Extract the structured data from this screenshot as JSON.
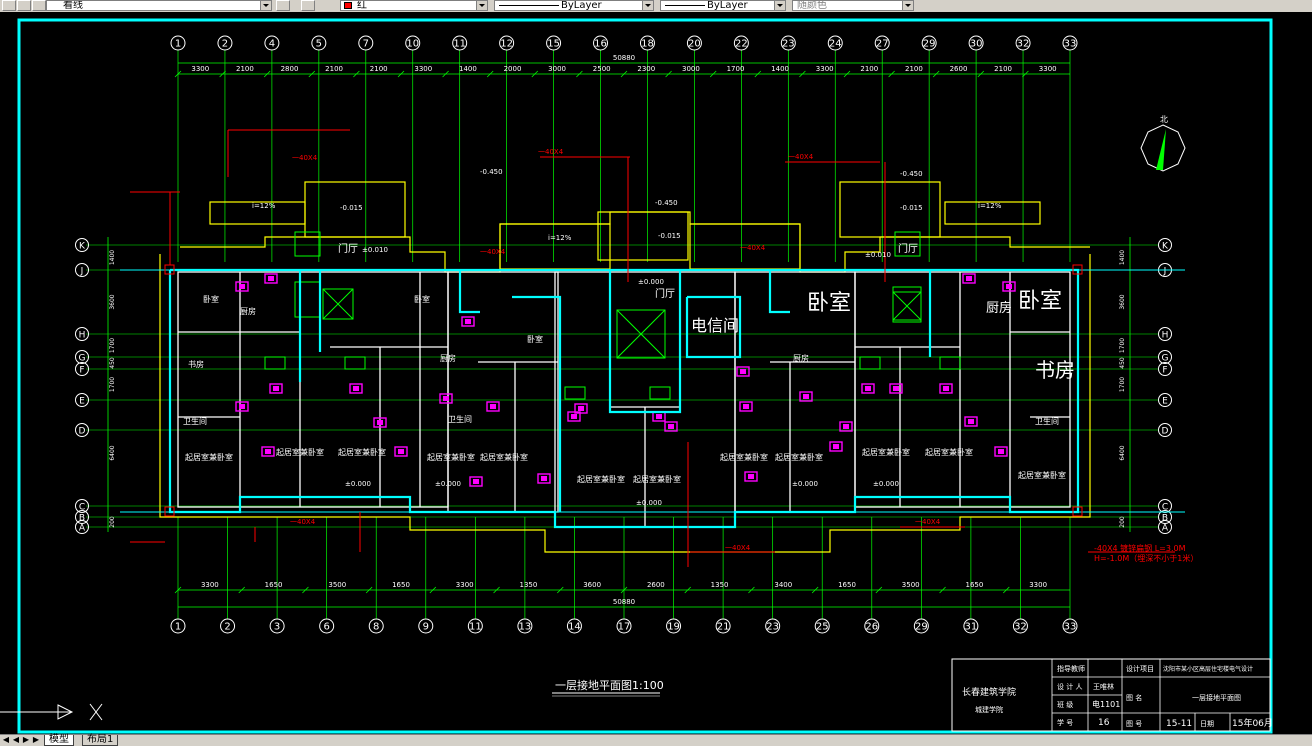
{
  "toolbar": {
    "layer_value": "看线",
    "color_value": "红",
    "linetype_value": "ByLayer",
    "lineweight_value": "ByLayer",
    "plotstyle_value": "随颜色"
  },
  "drawing": {
    "title": "一层接地平面图1:100",
    "top_axes": [
      "1",
      "2",
      "4",
      "5",
      "7",
      "10",
      "11",
      "12",
      "15",
      "16",
      "18",
      "20",
      "22",
      "23",
      "24",
      "27",
      "29",
      "30",
      "32",
      "33"
    ],
    "top_dims": [
      "3300",
      "2100",
      "2800",
      "2100",
      "2100",
      "3300",
      "1400",
      "2000",
      "3000",
      "2500",
      "2300",
      "3000",
      "1700",
      "1400",
      "3300",
      "2100",
      "2100",
      "2600",
      "2100",
      "3300"
    ],
    "top_total": "50880",
    "bottom_axes": [
      "1",
      "2",
      "3",
      "6",
      "8",
      "9",
      "11",
      "13",
      "14",
      "17",
      "19",
      "21",
      "23",
      "25",
      "26",
      "29",
      "31",
      "32",
      "33"
    ],
    "bottom_dims": [
      "3300",
      "1650",
      "3500",
      "1650",
      "3300",
      "1350",
      "3600",
      "2600",
      "1350",
      "3400",
      "1650",
      "3500",
      "1650",
      "3300"
    ],
    "bottom_total": "50880",
    "left_axes": [
      "K",
      "J",
      "H",
      "G",
      "F",
      "E",
      "D",
      "C",
      "B",
      "A"
    ],
    "left_dims": [
      "1400",
      "3600",
      "1700",
      "450",
      "1700",
      "6400",
      "200"
    ],
    "room_labels": {
      "bedroom_large": "卧室",
      "study_large": "书房",
      "kitchen_large": "厨房",
      "telecom": "电信间",
      "hall": "门厅",
      "bedroom": "卧室",
      "study": "书房",
      "kitchen": "厨房",
      "bath": "卫生间",
      "living": "起居室兼卧室"
    },
    "elevations": [
      "-0.450",
      "-0.015",
      "±0.000",
      "±0.010"
    ],
    "slope": "i=12%",
    "conductor_note": "一40X4",
    "red_note_1": "-40X4 镀锌扁钢 L=3.0M",
    "red_note_2": "H=-1.0M（埋深不小于1米）",
    "north": "北"
  },
  "title_block": {
    "school": "长春建筑学院",
    "dept": "城建学院",
    "r1c1": "指导教师",
    "r2c1": "设 计 人",
    "r2c2": "王唯林",
    "r3c1": "班 级",
    "r3c2": "电1101",
    "r4c1": "学 号",
    "r4c2": "16",
    "proj_label": "设计项目",
    "proj_value": "沈阳市某小区高层住宅楼电气设计",
    "drawing_name_label": "图 名",
    "drawing_name_value": "一层接地平面图",
    "drawing_no_label": "图 号",
    "drawing_no_value": "15-11",
    "date_label": "日期",
    "date_value": "15年06月"
  },
  "tabs": {
    "model": "模型",
    "layout1": "布局1"
  },
  "colors": {
    "cyan": "#00ffff",
    "yellow": "#ffff00",
    "green": "#00ff00",
    "red": "#ff0000",
    "magenta": "#ff00ff",
    "white": "#ffffff"
  }
}
